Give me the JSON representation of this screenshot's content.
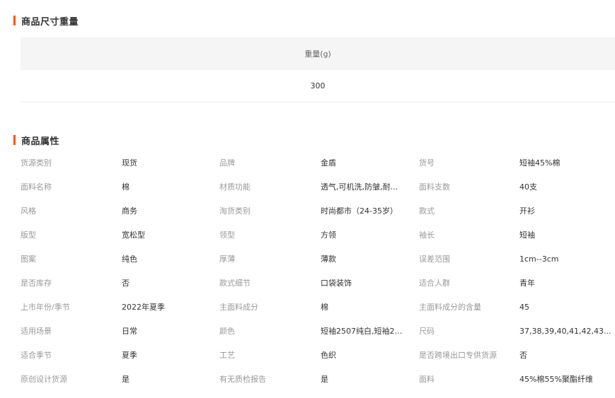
{
  "size_weight_section": {
    "title": "商品尺寸重量",
    "column_header": "重量(g)",
    "value": "300"
  },
  "attributes_section": {
    "title": "商品属性",
    "rows": [
      [
        {
          "label": "货源类别",
          "value": "现货"
        },
        {
          "label": "品牌",
          "value": "金盾"
        },
        {
          "label": "货号",
          "value": "短袖45%棉"
        }
      ],
      [
        {
          "label": "面料名称",
          "value": "棉"
        },
        {
          "label": "材质功能",
          "value": "透气,可机洗,防皱,耐..."
        },
        {
          "label": "面料支数",
          "value": "40支"
        }
      ],
      [
        {
          "label": "风格",
          "value": "商务"
        },
        {
          "label": "淘货类别",
          "value": "时尚都市（24-35岁）"
        },
        {
          "label": "款式",
          "value": "开衫"
        }
      ],
      [
        {
          "label": "版型",
          "value": "宽松型"
        },
        {
          "label": "领型",
          "value": "方领"
        },
        {
          "label": "袖长",
          "value": "短袖"
        }
      ],
      [
        {
          "label": "图案",
          "value": "纯色"
        },
        {
          "label": "厚薄",
          "value": "薄款"
        },
        {
          "label": "误差范围",
          "value": "1cm--3cm"
        }
      ],
      [
        {
          "label": "是否库存",
          "value": "否"
        },
        {
          "label": "款式细节",
          "value": "口袋装饰"
        },
        {
          "label": "适合人群",
          "value": "青年"
        }
      ],
      [
        {
          "label": "上市年份/季节",
          "value": "2022年夏季"
        },
        {
          "label": "主面料成分",
          "value": "棉"
        },
        {
          "label": "主面料成分的含量",
          "value": "45"
        }
      ],
      [
        {
          "label": "适用场景",
          "value": "日常"
        },
        {
          "label": "颜色",
          "value": "短袖2507纯白,短袖25..."
        },
        {
          "label": "尺码",
          "value": "37,38,39,40,41,42,43..."
        }
      ],
      [
        {
          "label": "适合季节",
          "value": "夏季"
        },
        {
          "label": "工艺",
          "value": "色织"
        },
        {
          "label": "是否跨境出口专供货源",
          "value": "否"
        }
      ],
      [
        {
          "label": "原创设计货源",
          "value": "是"
        },
        {
          "label": "有无质检报告",
          "value": "是"
        },
        {
          "label": "面料",
          "value": "45%棉55%聚酯纤维"
        }
      ]
    ]
  },
  "colors": {
    "accent": "#ff5000",
    "header_bg": "#f5f5f5",
    "label_text": "#999999",
    "value_text": "#333333"
  }
}
